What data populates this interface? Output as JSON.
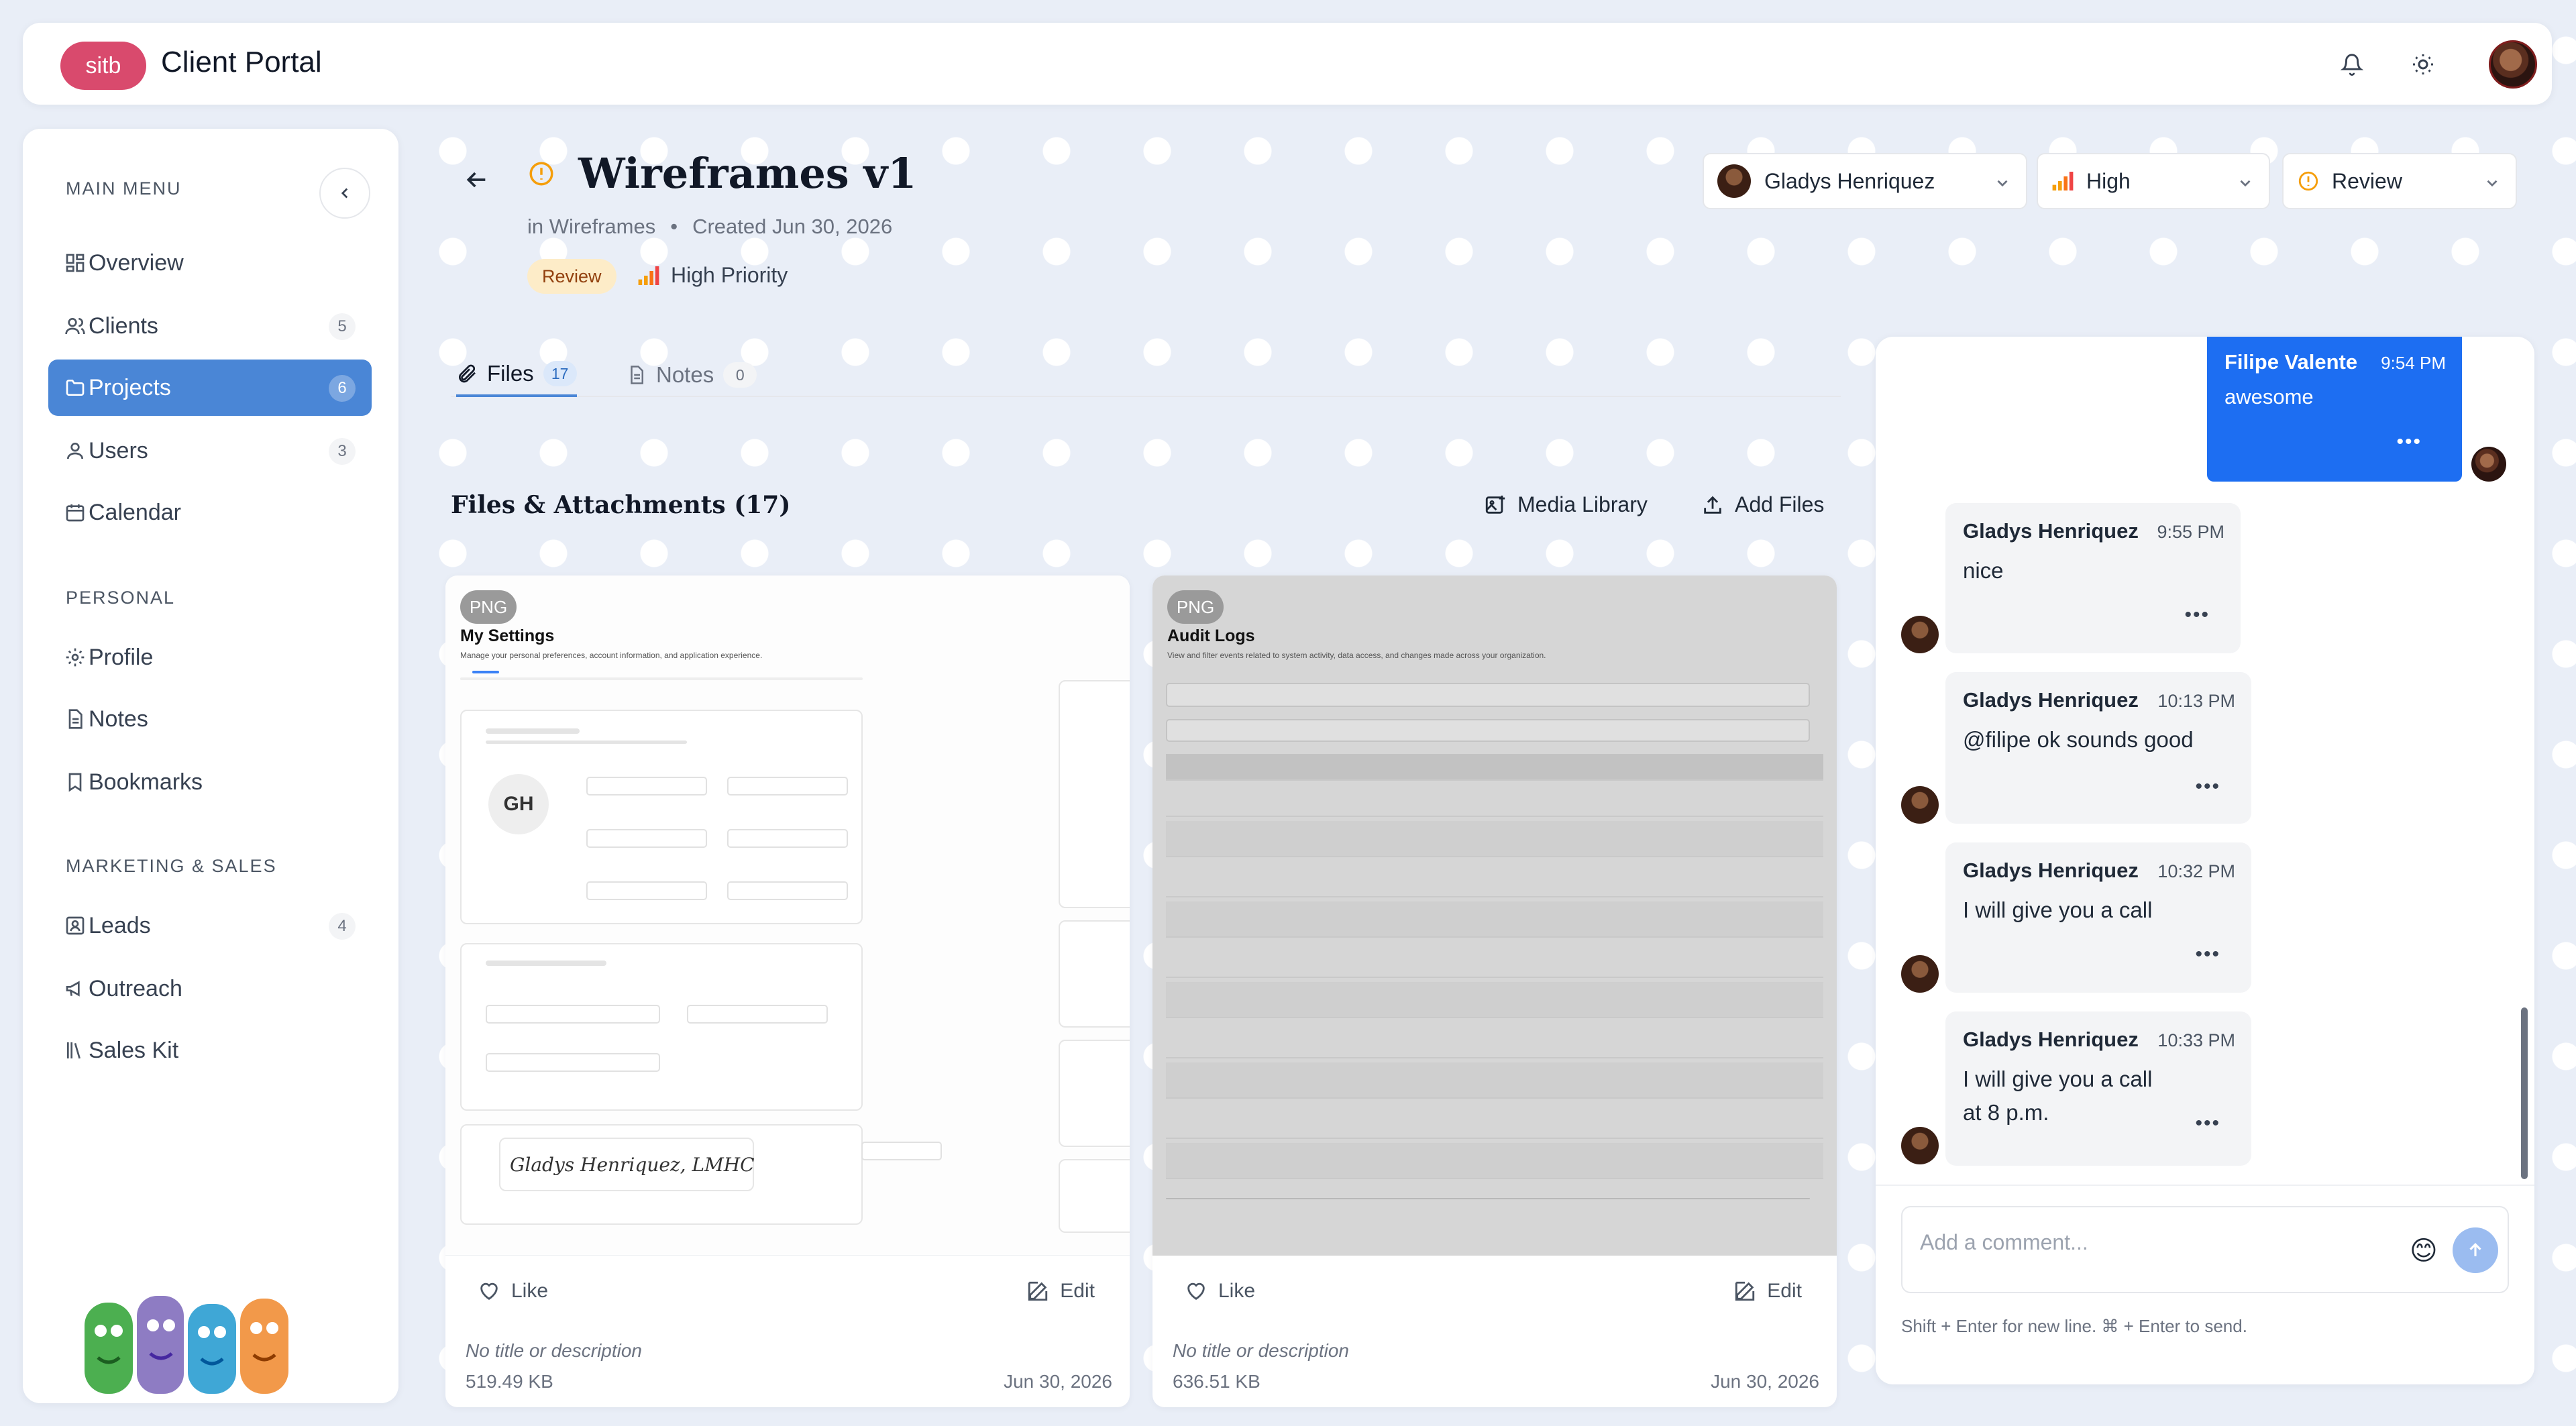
{
  "topbar": {
    "logo": "sitb",
    "title": "Client Portal",
    "icons": [
      "bell-icon",
      "sun-icon"
    ]
  },
  "sidebar": {
    "main_label": "MAIN MENU",
    "main_items": [
      {
        "label": "Overview",
        "icon": "grid-icon"
      },
      {
        "label": "Clients",
        "count": "5",
        "icon": "users-icon"
      },
      {
        "label": "Projects",
        "count": "6",
        "icon": "folder-icon",
        "active": true
      },
      {
        "label": "Users",
        "count": "3",
        "icon": "user-icon"
      },
      {
        "label": "Calendar",
        "icon": "calendar-icon"
      }
    ],
    "personal_label": "PERSONAL",
    "personal_items": [
      {
        "label": "Profile",
        "icon": "gear-icon"
      },
      {
        "label": "Notes",
        "icon": "document-icon"
      },
      {
        "label": "Bookmarks",
        "icon": "bookmark-icon"
      }
    ],
    "marketing_label": "MARKETING & SALES",
    "marketing_items": [
      {
        "label": "Leads",
        "count": "4",
        "icon": "contact-icon"
      },
      {
        "label": "Outreach",
        "icon": "megaphone-icon"
      },
      {
        "label": "Sales Kit",
        "icon": "library-icon"
      }
    ]
  },
  "project": {
    "title": "Wireframes v1",
    "folder": "in Wireframes",
    "created": "Created Jun 30, 2026",
    "status": "Review",
    "priority": "High Priority"
  },
  "dropdowns": {
    "assignee": "Gladys Henriquez",
    "priority": "High",
    "status": "Review"
  },
  "tabs": [
    {
      "label": "Files",
      "count": "17",
      "active": true
    },
    {
      "label": "Notes",
      "count": "0"
    }
  ],
  "files": {
    "heading": "Files & Attachments (17)",
    "media_library": "Media Library",
    "add_files": "Add Files",
    "items": [
      {
        "type": "PNG",
        "preview_title": "My Settings",
        "preview_subtitle": "Manage your personal preferences, account information, and application experience.",
        "preview_initials": "GH",
        "preview_signature": "Gladys Henriquez, LMHC",
        "like": "Like",
        "edit": "Edit",
        "description": "No title or description",
        "size": "519.49 KB",
        "date": "Jun 30, 2026"
      },
      {
        "type": "PNG",
        "preview_title": "Audit Logs",
        "preview_subtitle": "View and filter events related to system activity, data access, and changes made across your organization.",
        "like": "Like",
        "edit": "Edit",
        "description": "No title or description",
        "size": "636.51 KB",
        "date": "Jun 30, 2026"
      }
    ]
  },
  "chat": {
    "messages": [
      {
        "author": "Filipe Valente",
        "time": "9:54 PM",
        "text": "awesome",
        "mine": true
      },
      {
        "author": "Gladys Henriquez",
        "time": "9:55 PM",
        "text": "nice"
      },
      {
        "author": "Gladys Henriquez",
        "time": "10:13 PM",
        "text": "@filipe ok sounds good"
      },
      {
        "author": "Gladys Henriquez",
        "time": "10:32 PM",
        "text": "I will give you a call"
      },
      {
        "author": "Gladys Henriquez",
        "time": "10:33 PM",
        "text": "I will give you a call\nat 8 p.m."
      }
    ],
    "placeholder": "Add a comment...",
    "hint": "Shift + Enter for new line. ⌘ + Enter to send."
  }
}
